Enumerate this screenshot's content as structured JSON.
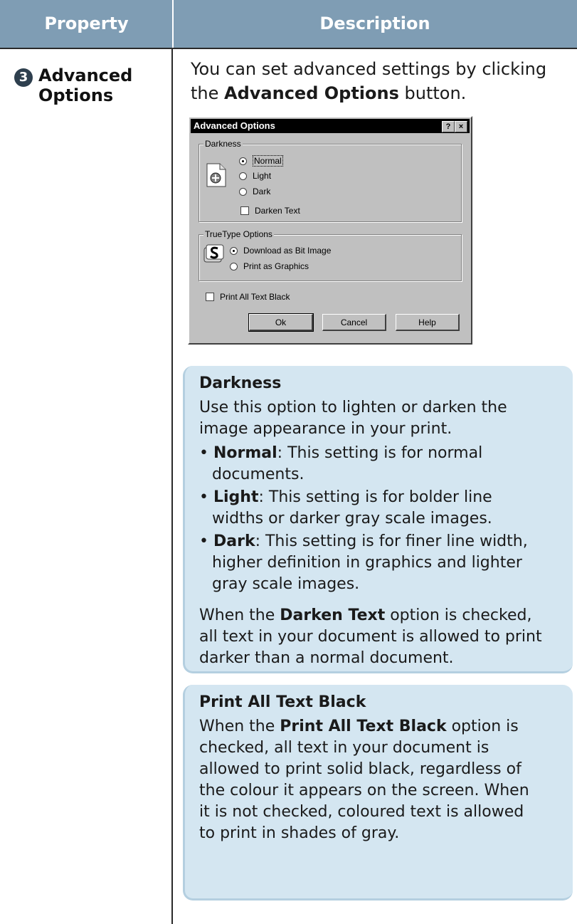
{
  "header": {
    "property": "Property",
    "description": "Description"
  },
  "row": {
    "number": "3",
    "property_line1": "Advanced",
    "property_line2": "Options",
    "intro_pre": "You can set advanced settings by clicking the ",
    "intro_bold": "Advanced Options",
    "intro_post": " button."
  },
  "dialog": {
    "title": "Advanced Options",
    "help_glyph": "?",
    "close_glyph": "×",
    "darkness_group": "Darkness",
    "darkness_options": [
      "Normal",
      "Light",
      "Dark"
    ],
    "darkness_selected": "Normal",
    "darken_text_label": "Darken Text",
    "darken_text_checked": false,
    "truetype_group": "TrueType Options",
    "truetype_options": [
      "Download as Bit Image",
      "Print as Graphics"
    ],
    "truetype_selected": "Download as Bit Image",
    "print_all_black_label": "Print All Text Black",
    "print_all_black_checked": false,
    "buttons": [
      "Ok",
      "Cancel",
      "Help"
    ]
  },
  "darkness_box": {
    "title": "Darkness",
    "intro_line1": "Use this option to lighten or darken the",
    "intro_line2": "image appearance in your print.",
    "items": [
      {
        "term": "Normal",
        "line1": ": This setting is for normal",
        "line2": "documents."
      },
      {
        "term": "Light",
        "line1": ": This setting is for bolder line",
        "line2": "widths or darker gray scale images."
      },
      {
        "term": "Dark",
        "line1": ": This setting is for finer line width,",
        "line2": "higher definition in graphics and lighter",
        "line3": "gray scale images."
      }
    ],
    "note_pre": "When the ",
    "note_bold": "Darken Text",
    "note_post1": " option is checked,",
    "note_line2": "all text in your document is allowed to print",
    "note_line3": "darker than a normal document."
  },
  "black_box": {
    "title": "Print All Text Black",
    "l1_pre": "When the ",
    "l1_bold": "Print All Text Black",
    "l1_post": " option is",
    "lines": [
      "checked, all text in your document is",
      "allowed to print solid black, regardless of",
      "the colour it appears on the screen. When",
      "it is not checked, coloured text is allowed",
      "to print in shades of gray."
    ]
  }
}
